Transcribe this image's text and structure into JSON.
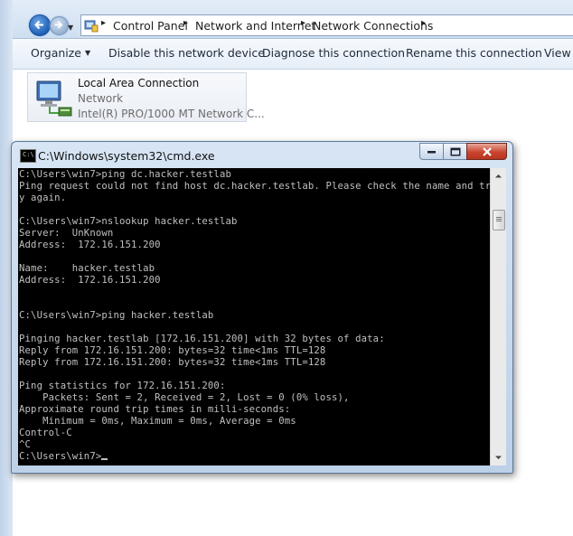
{
  "breadcrumbs": [
    "Control Panel",
    "Network and Internet",
    "Network Connections"
  ],
  "toolbar": {
    "organize": "Organize",
    "disable": "Disable this network device",
    "diagnose": "Diagnose this connection",
    "rename": "Rename this connection",
    "view": "View s"
  },
  "connection": {
    "name": "Local Area Connection",
    "status": "Network",
    "device": "Intel(R) PRO/1000 MT Network C..."
  },
  "cmd": {
    "title": "C:\\Windows\\system32\\cmd.exe",
    "icon_text": "C:\\",
    "lines": [
      "C:\\Users\\win7>ping dc.hacker.testlab",
      "Ping request could not find host dc.hacker.testlab. Please check the name and tr",
      "y again.",
      "",
      "C:\\Users\\win7>nslookup hacker.testlab",
      "Server:  UnKnown",
      "Address:  172.16.151.200",
      "",
      "Name:    hacker.testlab",
      "Address:  172.16.151.200",
      "",
      "",
      "C:\\Users\\win7>ping hacker.testlab",
      "",
      "Pinging hacker.testlab [172.16.151.200] with 32 bytes of data:",
      "Reply from 172.16.151.200: bytes=32 time<1ms TTL=128",
      "Reply from 172.16.151.200: bytes=32 time<1ms TTL=128",
      "",
      "Ping statistics for 172.16.151.200:",
      "    Packets: Sent = 2, Received = 2, Lost = 0 (0% loss),",
      "Approximate round trip times in milli-seconds:",
      "    Minimum = 0ms, Maximum = 0ms, Average = 0ms",
      "Control-C",
      "^C"
    ],
    "prompt": "C:\\Users\\win7>"
  }
}
